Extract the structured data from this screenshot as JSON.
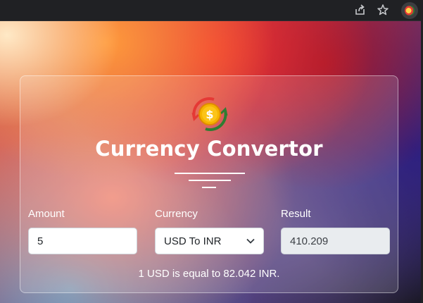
{
  "browser": {
    "icons": [
      "share-icon",
      "star-icon",
      "extension-icon"
    ]
  },
  "app": {
    "logo_icon": "currency-exchange-icon",
    "title": "Currency Convertor"
  },
  "form": {
    "amount": {
      "label": "Amount",
      "value": "5"
    },
    "currency": {
      "label": "Currency",
      "selected": "USD To INR"
    },
    "result": {
      "label": "Result",
      "value": "410.209"
    }
  },
  "note": "1 USD is equal to 82.042 INR.",
  "colors": {
    "card_border": "#ffffff",
    "result_bg": "#e9ecef",
    "logo_red": "#e53935",
    "logo_green": "#2e7d32",
    "logo_gold": "#f5b400"
  }
}
